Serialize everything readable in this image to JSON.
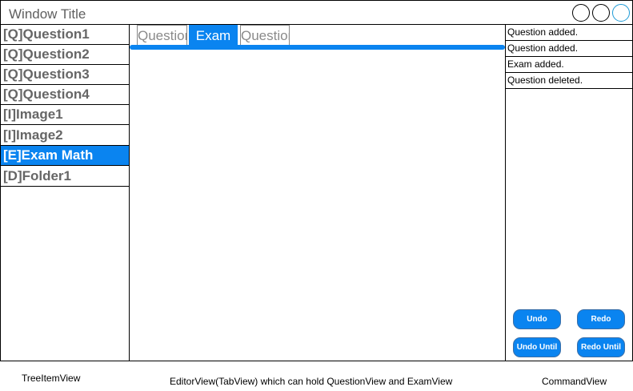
{
  "window": {
    "title": "Window Title"
  },
  "tree": {
    "items": [
      {
        "label": "[Q]Question1",
        "selected": false
      },
      {
        "label": "[Q]Question2",
        "selected": false
      },
      {
        "label": "[Q]Question3",
        "selected": false
      },
      {
        "label": "[Q]Question4",
        "selected": false
      },
      {
        "label": "[I]Image1",
        "selected": false
      },
      {
        "label": "[I]Image2",
        "selected": false
      },
      {
        "label": "[E]Exam Math",
        "selected": true
      },
      {
        "label": "[D]Folder1",
        "selected": false
      }
    ]
  },
  "editor": {
    "tabs": [
      {
        "label": "Question",
        "active": false
      },
      {
        "label": "Exam",
        "active": true
      },
      {
        "label": "Question",
        "active": false
      }
    ]
  },
  "command": {
    "log": [
      "Question added.",
      "Question added.",
      "Exam added.",
      "Question deleted."
    ],
    "buttons": {
      "undo": "Undo",
      "redo": "Redo",
      "undo_until": "Undo Until",
      "redo_until": "Redo Until"
    }
  },
  "captions": {
    "tree": "TreeItemView",
    "editor": "EditorView(TabView) which can hold QuestionView and ExamView",
    "command": "CommandView"
  },
  "colors": {
    "accent": "#0a84f0",
    "text_gray": "#666666"
  }
}
